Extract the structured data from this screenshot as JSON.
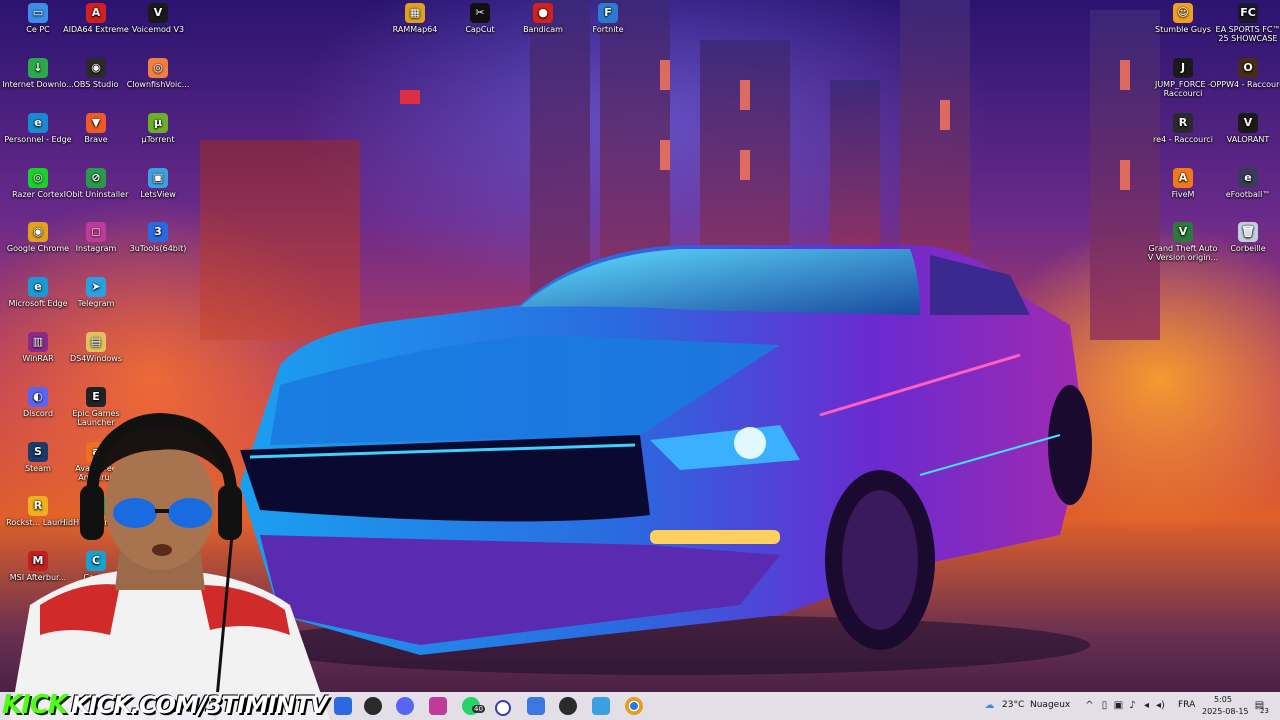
{
  "desktop": {
    "icons": [
      {
        "label": "Ce PC",
        "color": "#3a8ee6",
        "glyph": "▭"
      },
      {
        "label": "AIDA64 Extreme",
        "color": "#d02020",
        "glyph": "A"
      },
      {
        "label": "Voicemod V3",
        "color": "#1a1a1a",
        "glyph": "V"
      },
      {
        "label": "Internet Downlo...",
        "color": "#2aa84a",
        "glyph": "↓"
      },
      {
        "label": "OBS Studio",
        "color": "#2a2a2a",
        "glyph": "◉"
      },
      {
        "label": "ClownfishVoic...",
        "color": "#f08040",
        "glyph": "◎"
      },
      {
        "label": "Personnel - Edge",
        "color": "#1a8ad0",
        "glyph": "e"
      },
      {
        "label": "Brave",
        "color": "#f05a24",
        "glyph": "▼"
      },
      {
        "label": "µTorrent",
        "color": "#6ab02a",
        "glyph": "µ"
      },
      {
        "label": "Razer Cortex",
        "color": "#1ad02a",
        "glyph": "◎"
      },
      {
        "label": "IObit Uninstaller",
        "color": "#2a9a4a",
        "glyph": "⊘"
      },
      {
        "label": "LetsView",
        "color": "#3aa0e0",
        "glyph": "▣"
      },
      {
        "label": "Google Chrome",
        "color": "#e0a020",
        "glyph": "◉"
      },
      {
        "label": "Instagram",
        "color": "#c03a9a",
        "glyph": "◻"
      },
      {
        "label": "3uTools(64bit)",
        "color": "#2a6ae0",
        "glyph": "3"
      },
      {
        "label": "Microsoft Edge",
        "color": "#1a9ad0",
        "glyph": "e"
      },
      {
        "label": "Telegram",
        "color": "#2aa0e0",
        "glyph": "➤"
      },
      {
        "label": "WinRAR",
        "color": "#8a2a8a",
        "glyph": "▥"
      },
      {
        "label": "DS4Windows",
        "color": "#e0c060",
        "glyph": "▤"
      },
      {
        "label": "Discord",
        "color": "#5865f2",
        "glyph": "◐"
      },
      {
        "label": "Epic Games Launcher",
        "color": "#222222",
        "glyph": "E"
      },
      {
        "label": "Steam",
        "color": "#1a3a6a",
        "glyph": "S"
      },
      {
        "label": "Avast Free Antivirus",
        "color": "#f07020",
        "glyph": "a"
      },
      {
        "label": "Rockst... Laun...",
        "color": "#f0b020",
        "glyph": "R"
      },
      {
        "label": "HidHide Configu...",
        "color": "#2a9a4a",
        "glyph": "H"
      },
      {
        "label": "MSI Afterbur...",
        "color": "#c02020",
        "glyph": "M"
      },
      {
        "label": "Canva",
        "color": "#1aa0d0",
        "glyph": "C"
      },
      {
        "label": "RAMMap64",
        "color": "#e0a020",
        "glyph": "▦"
      },
      {
        "label": "CapCut",
        "color": "#111111",
        "glyph": "✂"
      },
      {
        "label": "Bandicam",
        "color": "#d02020",
        "glyph": "●"
      },
      {
        "label": "Fortnite",
        "color": "#2a7ad0",
        "glyph": "F"
      },
      {
        "label": "Stumble Guys",
        "color": "#f0a020",
        "glyph": "☺"
      },
      {
        "label": "EA SPORTS FC™ 25 SHOWCASE",
        "color": "#1a1a2a",
        "glyph": "FC"
      },
      {
        "label": "JUMP_FORCE - Raccourci",
        "color": "#1a1a1a",
        "glyph": "J"
      },
      {
        "label": "OPPW4 - Raccourci",
        "color": "#4a2a1a",
        "glyph": "O"
      },
      {
        "label": "re4 - Raccourci",
        "color": "#2a2a2a",
        "glyph": "R"
      },
      {
        "label": "VALORANT",
        "color": "#1a1a1a",
        "glyph": "V"
      },
      {
        "label": "FiveM",
        "color": "#f07a1a",
        "glyph": "A"
      },
      {
        "label": "eFootball™",
        "color": "#3a3a5a",
        "glyph": "e"
      },
      {
        "label": "Grand Theft Auto V Version origin...",
        "color": "#2a7a3a",
        "glyph": "V"
      },
      {
        "label": "Corbeille",
        "color": "#c0d0e0",
        "glyph": "🗑"
      }
    ]
  },
  "overlay": {
    "kick_logo": "KICK",
    "kick_url": "KICK.COM/3TIMINTV"
  },
  "taskbar": {
    "weather_temp": "23°C",
    "weather_desc": "Nuageux",
    "language": "FRA",
    "time": "5:05",
    "date": "2025-08-15",
    "whatsapp_badge": "40",
    "notification_count": "23"
  }
}
